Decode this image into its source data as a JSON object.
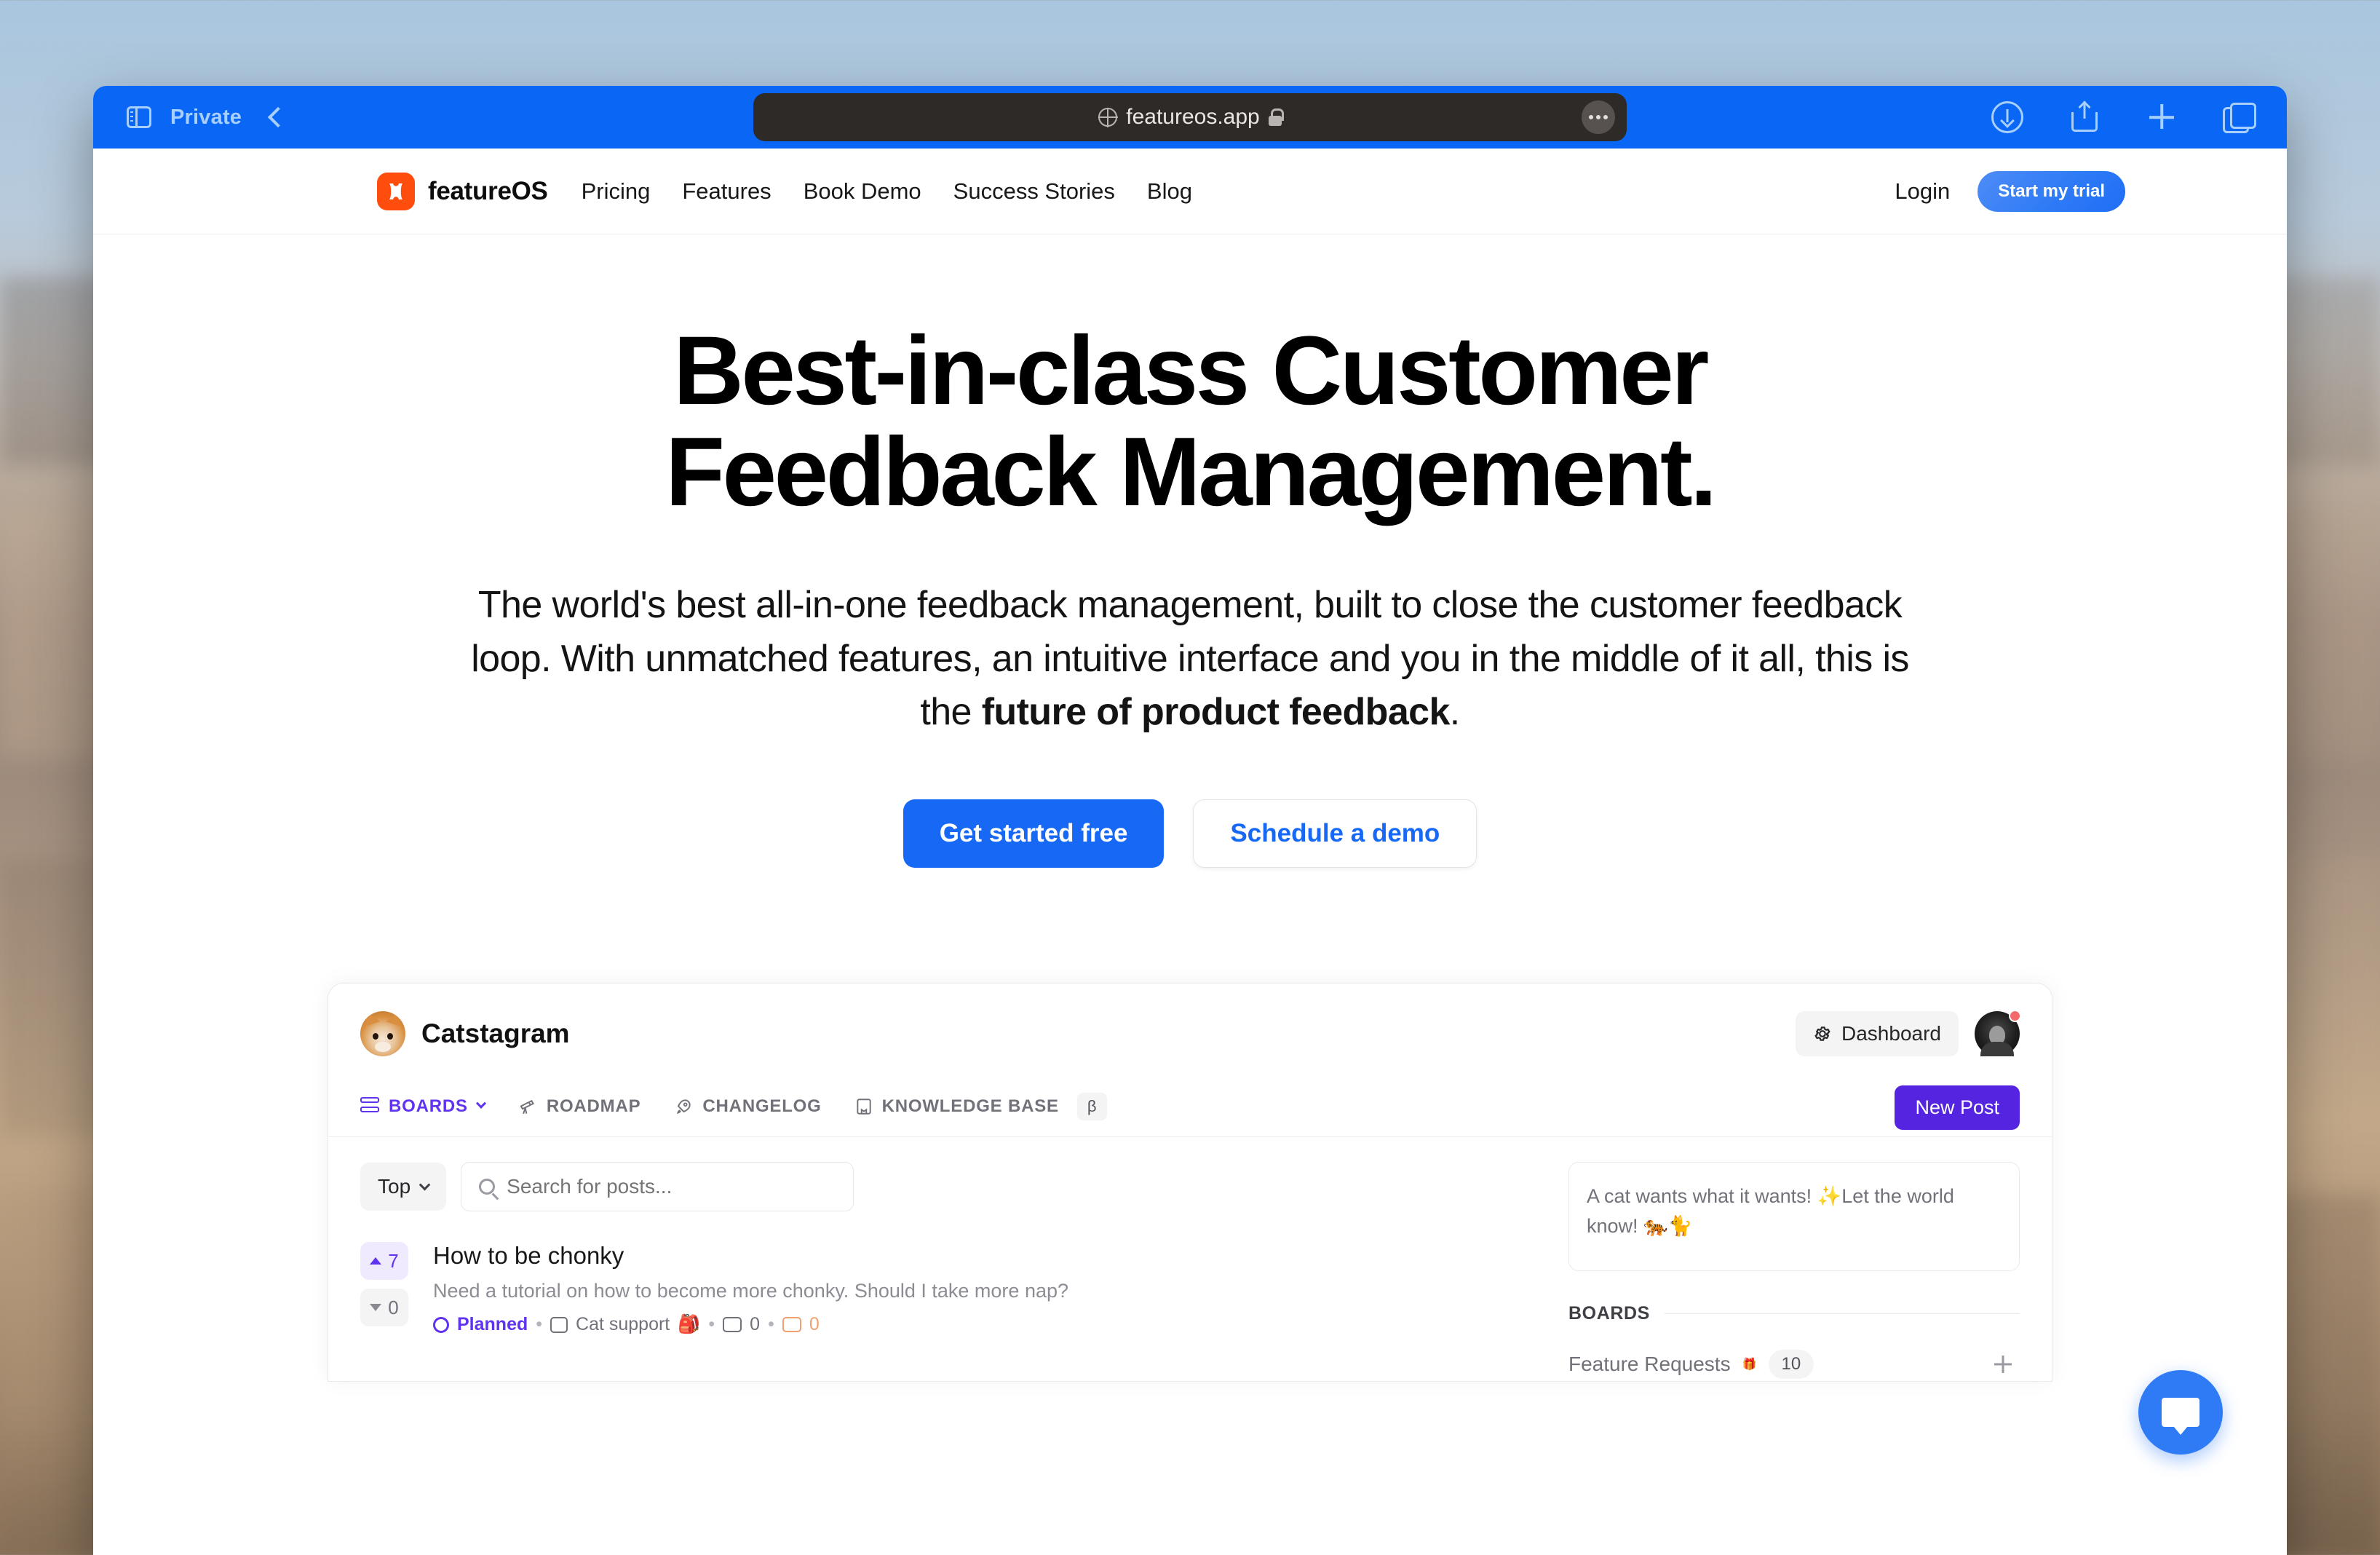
{
  "browser": {
    "private_label": "Private",
    "sidebar_icon": "sidebar-icon",
    "back_icon": "chevron-left-icon",
    "url": "featureos.app",
    "globe_icon": "globe-icon",
    "lock_icon": "lock-icon",
    "more_icon": "more-dots-icon",
    "download_icon": "download-icon",
    "share_icon": "share-icon",
    "new_tab_icon": "plus-icon",
    "tabs_icon": "tab-overview-icon",
    "accent": "#0a66f5"
  },
  "site_nav": {
    "logo_icon": "featureos-logo-icon",
    "brand": "featureOS",
    "links": [
      {
        "label": "Pricing"
      },
      {
        "label": "Features"
      },
      {
        "label": "Book Demo"
      },
      {
        "label": "Success Stories"
      },
      {
        "label": "Blog"
      }
    ],
    "login": "Login",
    "trial_button": "Start my trial",
    "logo_color": "#ff4d0d"
  },
  "hero": {
    "headline_line1": "Best-in-class Customer",
    "headline_line2": "Feedback Management.",
    "subtitle_part1": "The world's best all-in-one feedback management, built to close the customer feedback loop. With unmatched features, an intuitive interface and you in the middle of it all, this is the ",
    "subtitle_bold": "future of product feedback",
    "subtitle_part2": ".",
    "primary_cta": "Get started free",
    "secondary_cta": "Schedule a demo",
    "primary_color": "#1668f5"
  },
  "preview": {
    "workspace_name": "Catstagram",
    "workspace_avatar": "cat-avatar",
    "dashboard_button": "Dashboard",
    "dashboard_icon": "gear-icon",
    "user_avatar": "user-avatar",
    "tabs": [
      {
        "label": "BOARDS",
        "icon": "boards-icon",
        "active": true,
        "has_chevron": true
      },
      {
        "label": "ROADMAP",
        "icon": "telescope-icon",
        "active": false
      },
      {
        "label": "CHANGELOG",
        "icon": "rocket-icon",
        "active": false
      },
      {
        "label": "KNOWLEDGE BASE",
        "icon": "book-icon",
        "active": false,
        "badge": "β"
      }
    ],
    "new_post_button": "New Post",
    "new_post_color": "#5424e0",
    "sort_select": "Top",
    "search_placeholder": "Search for posts...",
    "search_icon": "search-icon",
    "posts": [
      {
        "upvotes": "7",
        "downvotes": "0",
        "title": "How to be chonky",
        "description": "Need a tutorial on how to become more chonky. Should I take more nap?",
        "status": "Planned",
        "board": "Cat support",
        "board_emoji": "🎒",
        "comments": "0",
        "replies": "0"
      }
    ],
    "sidebar": {
      "promo_text": "A cat wants what it wants! ✨Let the world know! 🐅🐈",
      "boards_label": "BOARDS",
      "boards": [
        {
          "name": "Feature Requests",
          "emoji": "🎁",
          "count": "10"
        }
      ],
      "add_icon": "plus-icon"
    },
    "accent": "#6033f0"
  },
  "chat": {
    "icon": "chat-bubble-icon",
    "color": "#2f7bf6"
  }
}
